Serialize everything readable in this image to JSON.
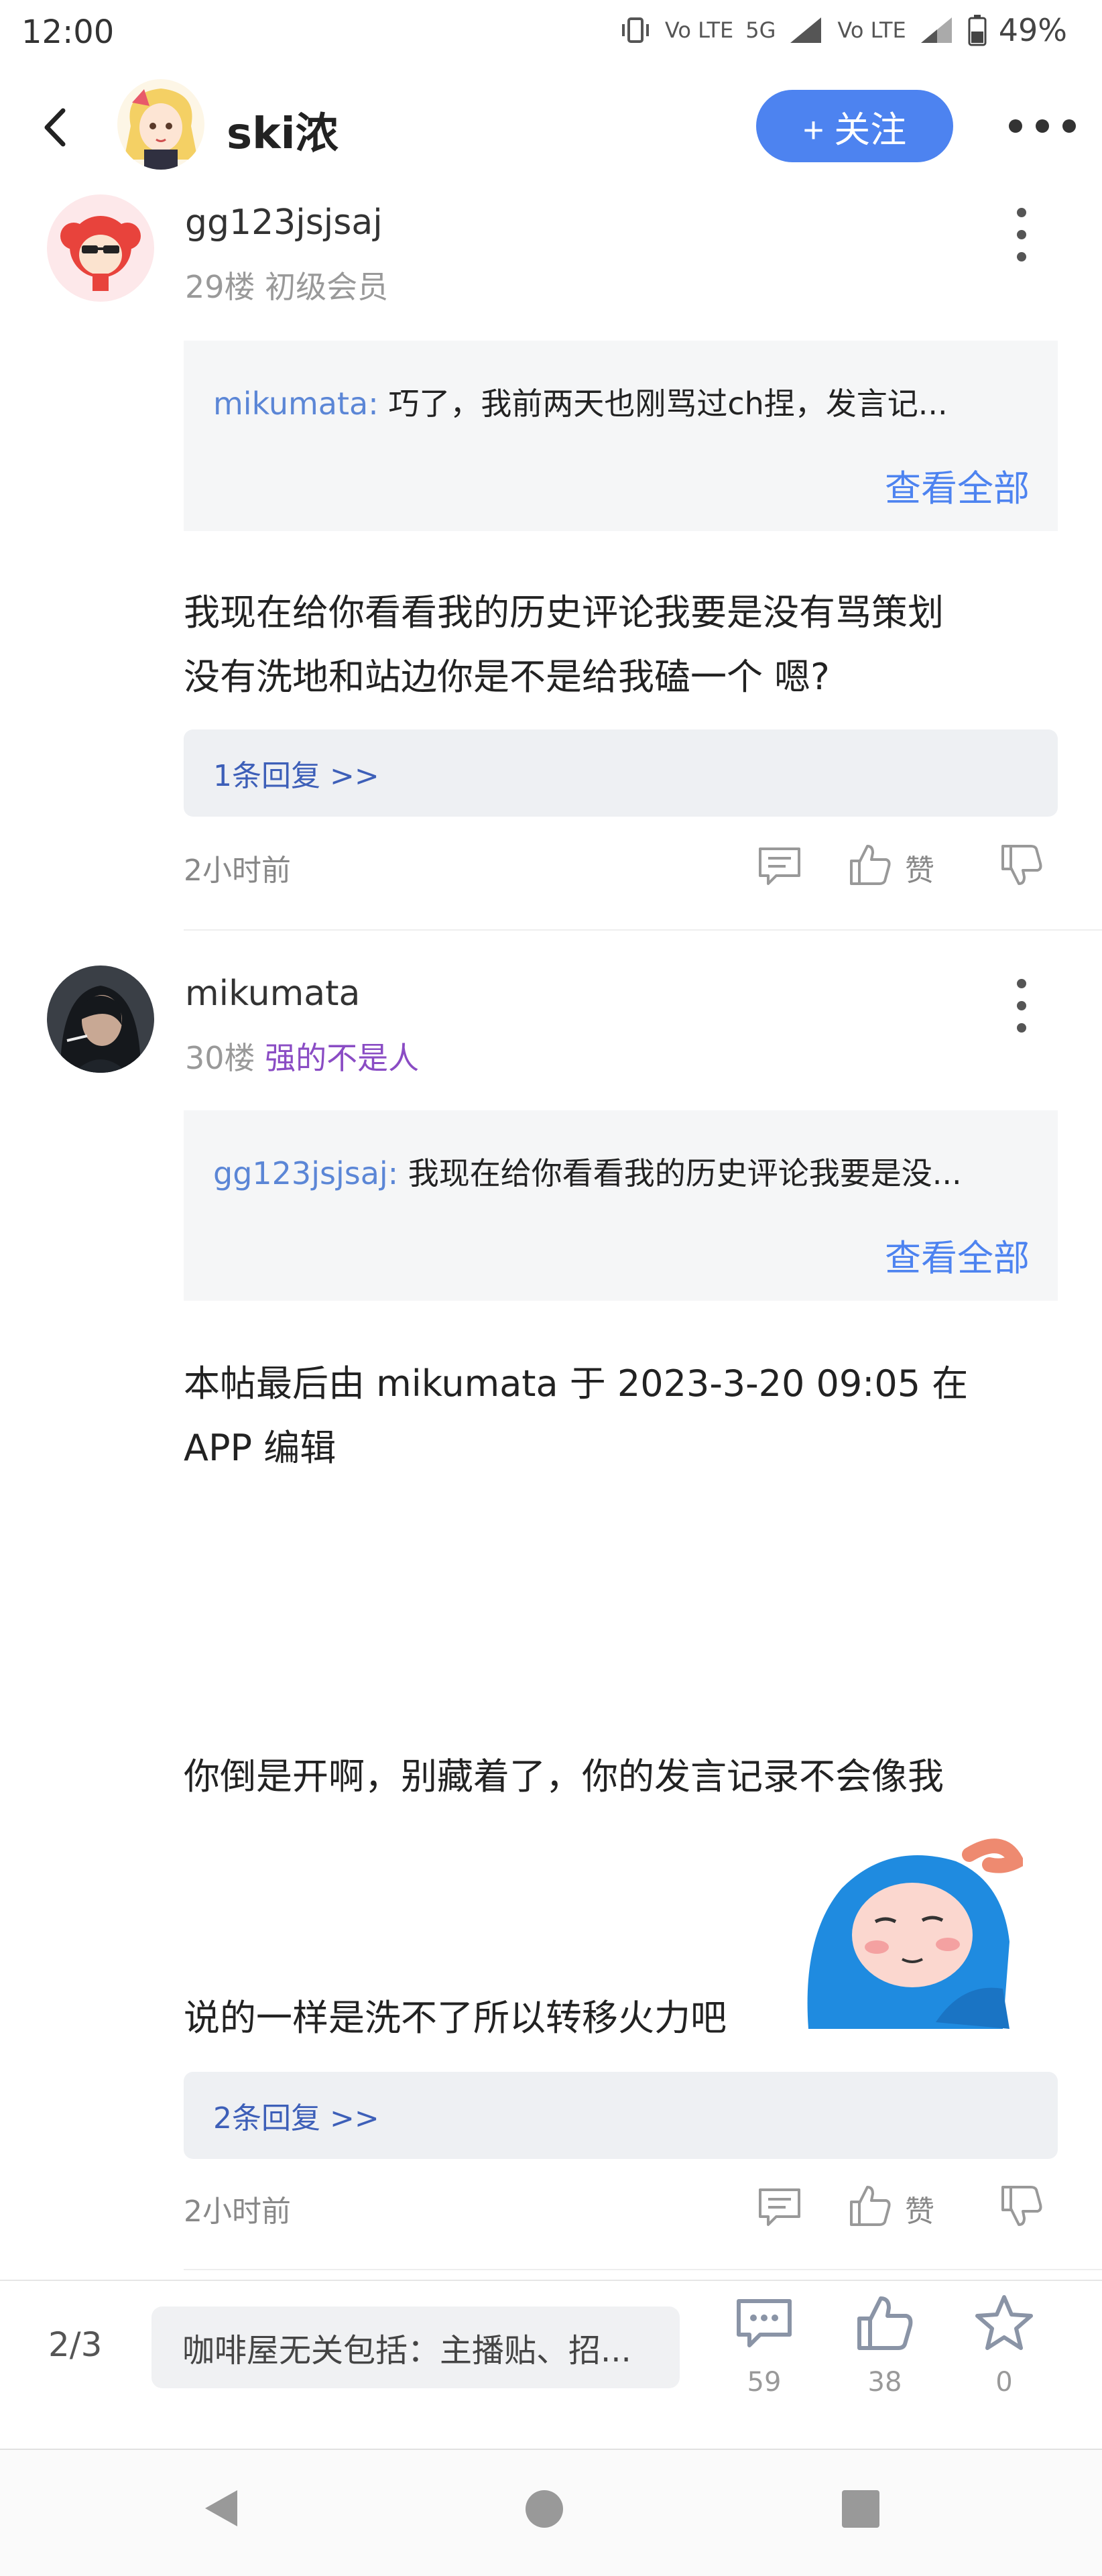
{
  "status_bar": {
    "time": "12:00",
    "vibrate_icon": "vibrate-icon",
    "volte_label": "Vo LTE",
    "network_label": "5G",
    "battery_percent": "49%"
  },
  "header": {
    "title": "ski浓",
    "follow_label": "+ 关注",
    "back_icon": "back-arrow-icon",
    "more_icon": "more-horizontal-icon",
    "accent_color": "#4d83f0"
  },
  "comments": [
    {
      "username": "gg123jsjsaj",
      "floor": "29楼",
      "level": "初级会员",
      "quote_author": "mikumata:",
      "quote_text": "巧了，我前两天也刚骂过ch捏，发言记...",
      "view_all": "查看全部",
      "body_lines": [
        "我现在给你看看我的历史评论我要是没有骂策划",
        "没有洗地和站边你是不是给我磕一个 嗯?"
      ],
      "reply_link": "1条回复 >>",
      "time": "2小时前",
      "like_label": "赞"
    },
    {
      "username": "mikumata",
      "floor": "30楼",
      "level": "强的不是人",
      "level_color": "#8a4cc4",
      "quote_author": "gg123jsjsaj:",
      "quote_text": "我现在给你看看我的历史评论我要是没...",
      "view_all": "查看全部",
      "body_lines": [
        "本帖最后由 mikumata 于 2023-3-20 09:05 在",
        "APP 编辑",
        "你倒是开啊，别藏着了，你的发言记录不会像我",
        "说的一样是洗不了所以转移火力吧"
      ],
      "sticker": "blue-hooded-character-sticker",
      "reply_link": "2条回复 >>",
      "time": "2小时前",
      "like_label": "赞"
    }
  ],
  "bottom_bar": {
    "page_indicator": "2/3",
    "forum_text": "咖啡屋无关包括：主播贴、招...",
    "comment_count": "59",
    "like_count": "38",
    "favorite_count": "0"
  },
  "nav_bar": {
    "back": "nav-back-icon",
    "home": "nav-home-icon",
    "recents": "nav-recents-icon"
  }
}
